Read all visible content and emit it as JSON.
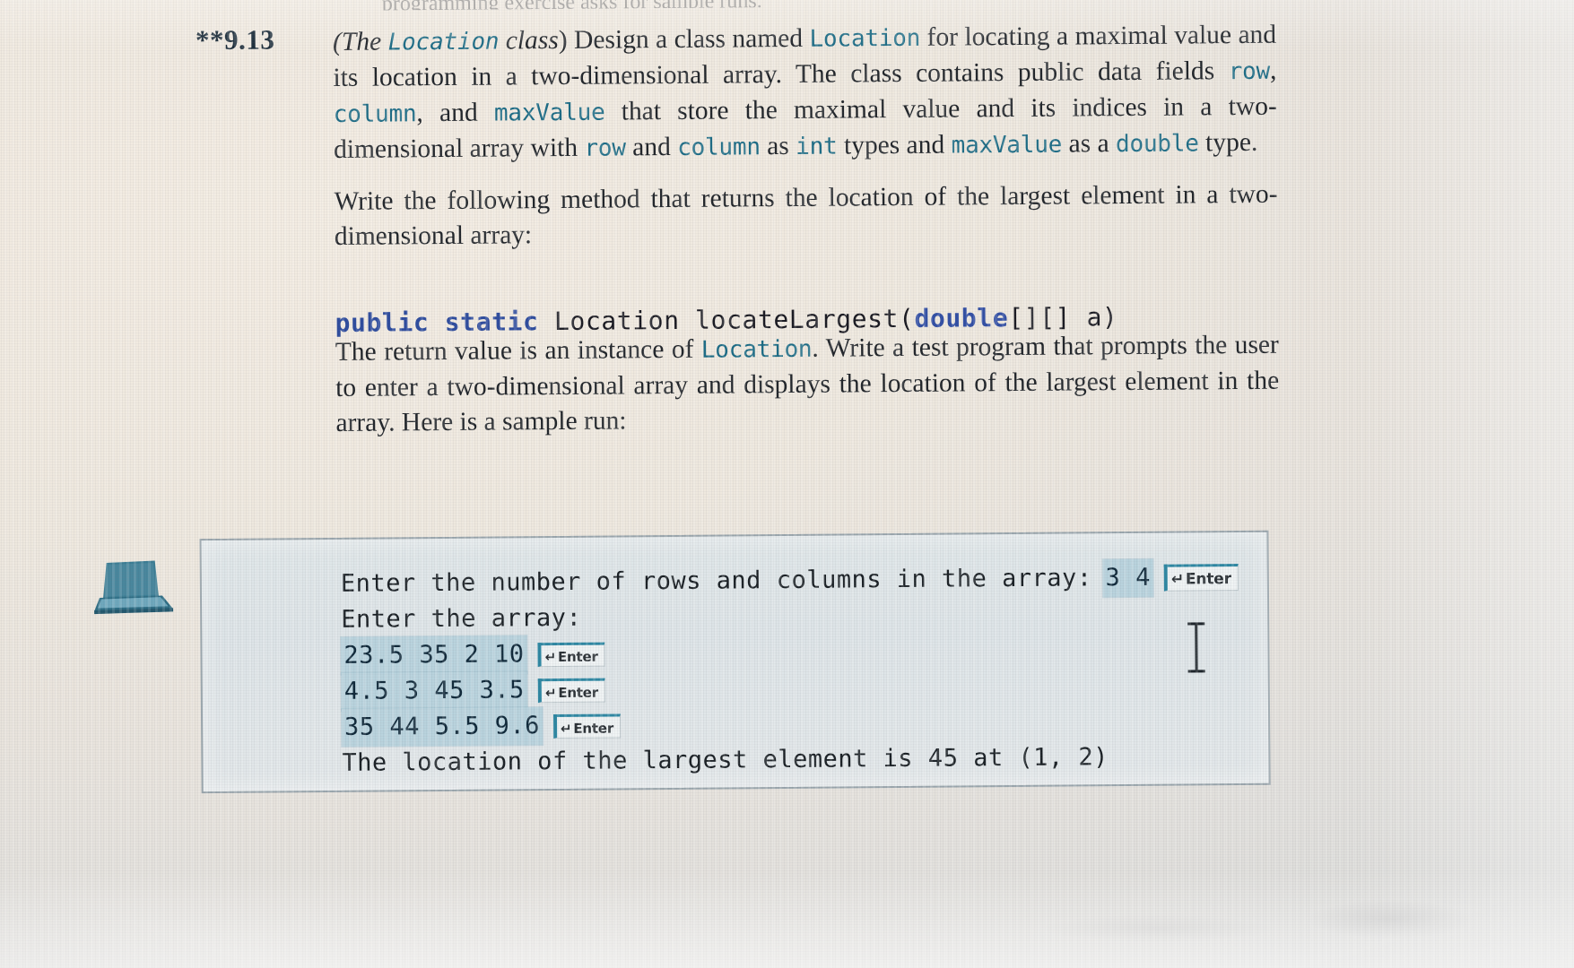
{
  "page": {
    "cutoff_top_line": "programming exercise asks for sample runs.",
    "exercise_number": "**9.13"
  },
  "exercise": {
    "title_italic_prefix": "(",
    "title_italic": "The ",
    "title_code": "Location",
    "title_italic_suffix": " class",
    "title_close": ")",
    "para1_a": " Design a class named ",
    "para1_code1": "Location",
    "para1_b": " for locating a maximal value and its location in a two-dimensional array. The class contains public data fields ",
    "para1_code2": "row",
    "para1_c": ", ",
    "para1_code3": "column",
    "para1_d": ", and ",
    "para1_code4": "maxValue",
    "para1_e": " that store the maximal value and its indices in a two-dimensional array with ",
    "para1_code5": "row",
    "para1_f": " and ",
    "para1_code6": "column",
    "para1_g": " as ",
    "para1_code7": "int",
    "para1_h": " types and ",
    "para1_code8": "maxValue",
    "para1_i": " as a ",
    "para1_code9": "double",
    "para1_j": " type.",
    "para2": "Write the following method that returns the location of the largest element in a two-dimensional array:",
    "code_signature": {
      "kw1": "public static",
      "mid": " Location locateLargest(",
      "kw2": "double",
      "tail": "[][] a)"
    },
    "para3_a": "The return value is an instance of ",
    "para3_code1": "Location",
    "para3_b": ". Write a test program that prompts the user to enter a two-dimensional array and displays the location of the largest element in the array. Here is a sample run:"
  },
  "sample_run": {
    "line1_prompt": "Enter the number of rows and columns in the array:",
    "line1_input": "3 4",
    "line1_enter": "Enter",
    "line2_prompt": "Enter the array:",
    "rows": [
      {
        "input": "23.5 35 2 10",
        "enter": "Enter"
      },
      {
        "input": "4.5 3 45 3.5",
        "enter": "Enter"
      },
      {
        "input": "35 44 5.5 9.6",
        "enter": "Enter"
      }
    ],
    "result": "The location of the largest element is 45 at (1, 2)"
  },
  "icons": {
    "laptop": "laptop-icon",
    "enter_key_glyph": "↵",
    "text_cursor": "i-beam-text-cursor"
  },
  "colors": {
    "paper": "#efe9e0",
    "body_text": "#22262b",
    "code_teal": "#1d6c86",
    "code_blue": "#2f4d9e",
    "sample_box_bg": "#dfe6e8",
    "sample_box_border": "#9aa6ad",
    "input_highlight": "#b9d3dd",
    "enter_key_accent": "#2f88a3",
    "laptop_icon": "#3d7e95"
  }
}
